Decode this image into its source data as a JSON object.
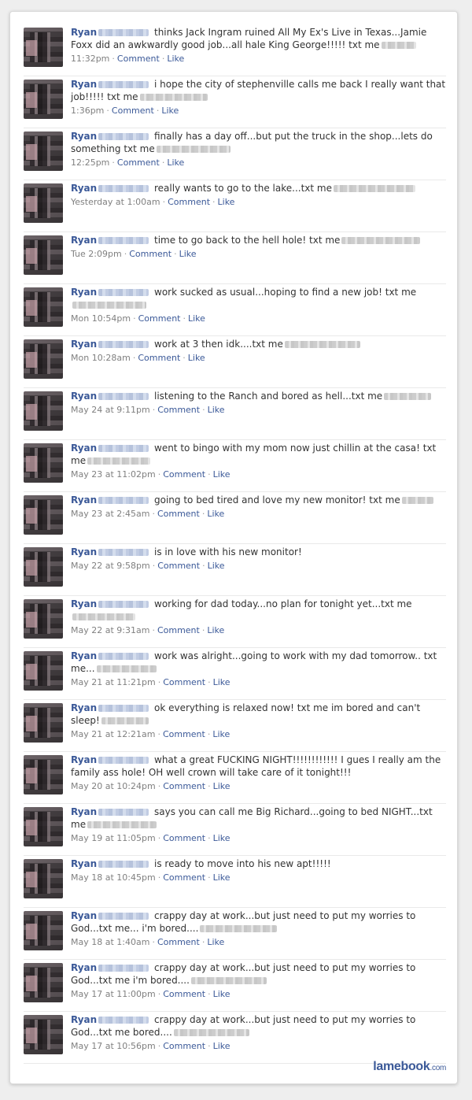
{
  "user": {
    "first_name": "Ryan"
  },
  "labels": {
    "comment": "Comment",
    "like": "Like"
  },
  "brand": {
    "name": "lamebook",
    "tld": ".com",
    "color": "#3b5998"
  },
  "colors": {
    "link": "#3b5998",
    "text": "#333333",
    "meta": "#808080"
  },
  "posts": [
    {
      "text": "thinks Jack Ingram ruined All My Ex's Live in Texas...Jamie Foxx did an awkwardly good job...all hale King George!!!!! txt me",
      "time": "11:32pm"
    },
    {
      "text": "i hope the city of stephenville calls me back I really want that job!!!!! txt me",
      "time": "1:36pm"
    },
    {
      "text": "finally has a day off...but put the truck in the shop...lets do something txt me",
      "time": "12:25pm"
    },
    {
      "text": "really wants to go to the lake...txt me",
      "time": "Yesterday at 1:00am"
    },
    {
      "text": "time to go back to the hell hole! txt me",
      "time": "Tue 2:09pm"
    },
    {
      "text": "work sucked as usual...hoping to find a new job! txt me",
      "time": "Mon 10:54pm"
    },
    {
      "text": "work at 3 then idk....txt me",
      "time": "Mon 10:28am"
    },
    {
      "text": "listening to the Ranch and bored as hell...txt me",
      "time": "May 24 at 9:11pm"
    },
    {
      "text": "went to bingo with my mom now just chillin at the casa! txt me",
      "time": "May 23 at 11:02pm"
    },
    {
      "text": "going to bed tired and love my new monitor! txt me",
      "time": "May 23 at 2:45am"
    },
    {
      "text": "is in love with his new monitor!",
      "time": "May 22 at 9:58pm"
    },
    {
      "text": "working for dad today...no plan for tonight yet...txt me",
      "time": "May 22 at 9:31am"
    },
    {
      "text": "work was alright...going to work with my dad tomorrow.. txt me...",
      "time": "May 21 at 11:21pm"
    },
    {
      "text": "ok everything is relaxed now! txt me im bored and can't sleep!",
      "time": "May 21 at 12:21am"
    },
    {
      "text": "what a great FUCKING NIGHT!!!!!!!!!!!! I gues I really am the family ass hole! OH well crown will take care of it tonight!!!",
      "time": "May 20 at 10:24pm"
    },
    {
      "text": "says you can call me Big Richard...going to bed NIGHT...txt me",
      "time": "May 19 at 11:05pm"
    },
    {
      "text": "is ready to move into his new apt!!!!!",
      "time": "May 18 at 10:45pm"
    },
    {
      "text": "crappy day at work...but just need to put my worries to God...txt me... i'm bored....",
      "time": "May 18 at 1:40am"
    },
    {
      "text": "crappy day at work...but just need to put my worries to God...txt me i'm bored....",
      "time": "May 17 at 11:00pm"
    },
    {
      "text": "crappy day at work...but just need to put my worries to God...txt me bored....",
      "time": "May 17 at 10:56pm"
    }
  ]
}
